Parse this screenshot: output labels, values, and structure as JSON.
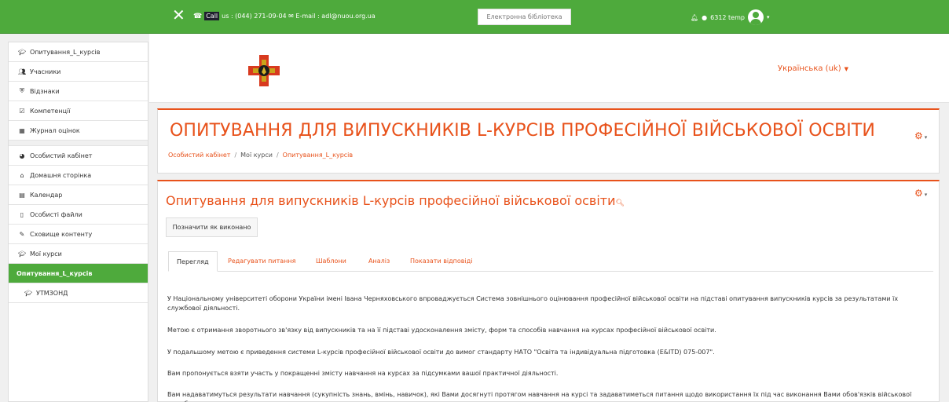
{
  "topbar": {
    "close_icon": "close-icon",
    "call_label": "Call",
    "contact_text": "us : (044) 271-09-04 ✉ E-mail : adl@nuou.org.ua",
    "library_button": "Електронна бібліотека",
    "bell_icon": "bell-icon",
    "message_icon": "message-icon",
    "username": "6312 temp",
    "avatar_icon": "user-avatar-icon"
  },
  "sidebar": {
    "items": [
      {
        "label": "Опитування_L_курсів",
        "icon": "graduation-cap-icon"
      },
      {
        "label": "Учасники",
        "icon": "users-icon"
      },
      {
        "label": "Відзнаки",
        "icon": "shield-icon"
      },
      {
        "label": "Компетенції",
        "icon": "checkbox-icon"
      },
      {
        "label": "Журнал оцінок",
        "icon": "table-icon"
      },
      {
        "label": "Особистий кабінет",
        "icon": "dashboard-icon"
      },
      {
        "label": "Домашня сторінка",
        "icon": "home-icon"
      },
      {
        "label": "Календар",
        "icon": "calendar-icon"
      },
      {
        "label": "Особисті файли",
        "icon": "file-icon"
      },
      {
        "label": "Сховище контенту",
        "icon": "brush-icon"
      },
      {
        "label": "Мої курси",
        "icon": "graduation-cap-icon"
      },
      {
        "label": "Опитування_L_курсів",
        "icon": ""
      },
      {
        "label": "УТМЗОНД",
        "icon": "graduation-cap-icon"
      }
    ]
  },
  "header": {
    "language": "Українська (uk)"
  },
  "course": {
    "title": "ОПИТУВАННЯ ДЛЯ ВИПУСКНИКІВ L-КУРСІВ ПРОФЕСІЙНОЇ ВІЙСЬКОВОЇ ОСВІТИ",
    "breadcrumb": [
      "Особистий кабінет",
      "Мої курси",
      "Опитування_L_курсів"
    ]
  },
  "activity": {
    "title": "Опитування для випускників L-курсів професійної військової освіти",
    "mark_done": "Позначити як виконано",
    "tabs": [
      "Перегляд",
      "Редагувати питання",
      "Шаблони",
      "Аналіз",
      "Показати відповіді"
    ],
    "paragraphs": [
      "У Національному університеті оборони України імені Івана Черняховського впроваджується Система зовнішнього оцінювання професійної військової освіти на підставі опитування випускників курсів за результатами їх службової діяльності.",
      "Метою є отримання зворотнього зв'язку від випускників та на її підставі удосконалення змісту, форм та способів навчання на курсах професійної військової освіти.",
      "У подальшому метою є приведення системи L-курсів професійної військової освіти до вимог стандарту НАТО \"Освіта та індивідуальна підготовка (E&ITD) 075-007\".",
      "Вам пропонується взяти участь у покращенні змісту навчання на курсах за підсумками вашої практичної діяльності.",
      "Вам надаватимуться результати навчання (сукупність знань, вмінь, навичок), які Вами досягнуті протягом навчання на курсі та задаватиметься питання щодо використання їх під час виконання Вами обов'язків військової служби."
    ]
  }
}
